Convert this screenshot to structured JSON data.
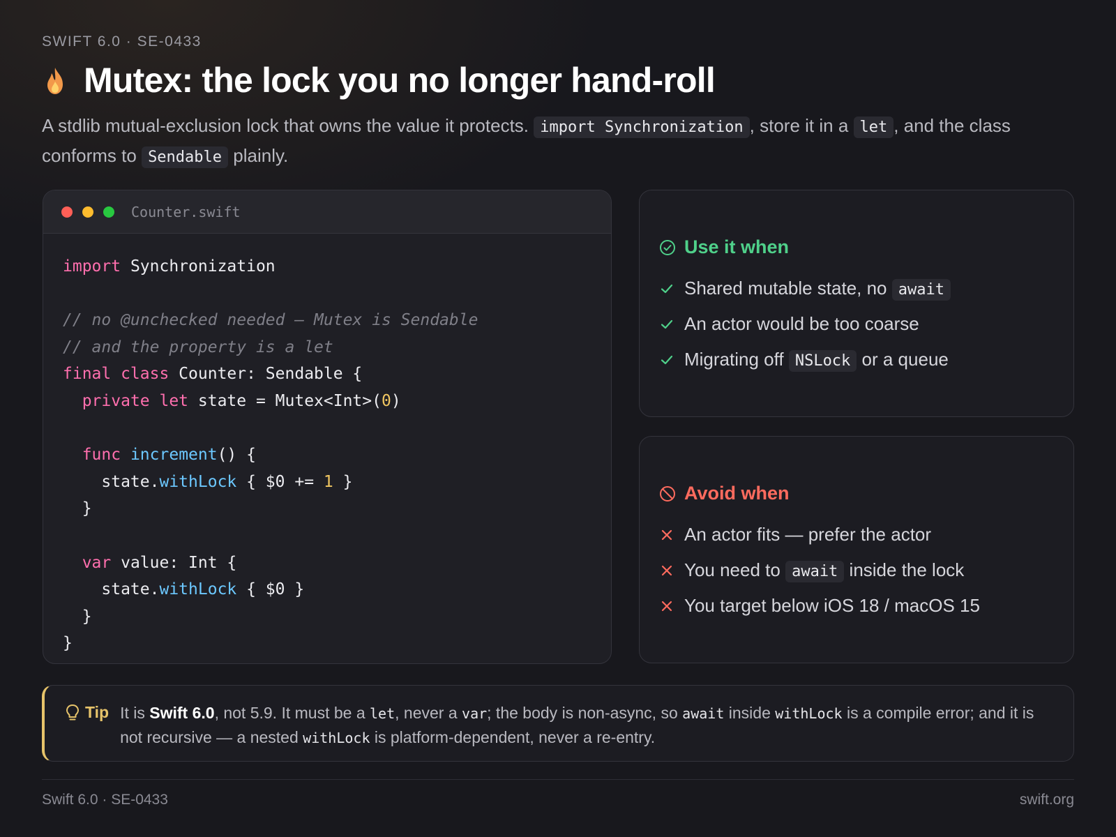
{
  "eyebrow": "SWIFT 6.0 · SE-0433",
  "title": "Mutex: the lock you no longer hand-roll",
  "lede": {
    "t1": "A stdlib mutual-exclusion lock that owns the value it protects. ",
    "c1": "import Synchronization",
    "t2": ", store it in a ",
    "c2": "let",
    "t3": ", and the class conforms to ",
    "c3": "Sendable",
    "t4": " plainly."
  },
  "code_card": {
    "filename": "Counter.swift",
    "dot_colors": [
      "#ff5f57",
      "#febc2e",
      "#28c840"
    ],
    "lines": {
      "l1_kw": "import",
      "l1_rest": " Synchronization",
      "l3": "// no @unchecked needed — Mutex is Sendable",
      "l4": "// and the property is a let",
      "l5_kw": "final class",
      "l5_rest": " Counter: Sendable {",
      "l6_kw": "private let",
      "l6_rest": " state = Mutex<Int>(",
      "l6_num": "0",
      "l6_end": ")",
      "l8_kw": "func",
      "l8_fn": "increment",
      "l8_rest": "() {",
      "l9_a": "state.",
      "l9_fn": "withLock",
      "l9_b": " { $0 += ",
      "l9_num": "1",
      "l9_c": " }",
      "l10": "}",
      "l12_kw": "var",
      "l12_rest": " value: Int {",
      "l13_a": "state.",
      "l13_fn": "withLock",
      "l13_b": " { $0 }",
      "l14": "}",
      "l15": "}"
    }
  },
  "use_panel": {
    "heading": "Use it when",
    "icon": "check-circle-icon",
    "color": "#4fd08a",
    "items": [
      {
        "text": "Shared mutable state, no ",
        "code": "await",
        "after": ""
      },
      {
        "text": "An actor would be too coarse"
      },
      {
        "text": "Migrating off ",
        "code": "NSLock",
        "after": " or a queue"
      }
    ]
  },
  "avoid_panel": {
    "heading": "Avoid when",
    "icon": "prohibited-icon",
    "color": "#ff6b5e",
    "items": [
      {
        "text": "An actor fits — prefer the actor"
      },
      {
        "text": "You need to ",
        "code": "await",
        "after": " inside the lock"
      },
      {
        "text": "You target below iOS 18 / macOS 15"
      }
    ]
  },
  "tip": {
    "label": "Tip",
    "p1": "It is ",
    "b1": "Swift 6.0",
    "p2": ", not 5.9. It must be a ",
    "c1": "let",
    "p3": ", never a ",
    "c2": "var",
    "p4": "; the body is non-async, so ",
    "c3": "await",
    "p5": " inside ",
    "c4": "withLock",
    "p6": " is a compile error; and it is not recursive — a nested ",
    "c5": "withLock",
    "p7": " is platform-dependent, never a re-entry."
  },
  "footer": {
    "left": "Swift 6.0 · SE-0433",
    "right": "swift.org"
  }
}
